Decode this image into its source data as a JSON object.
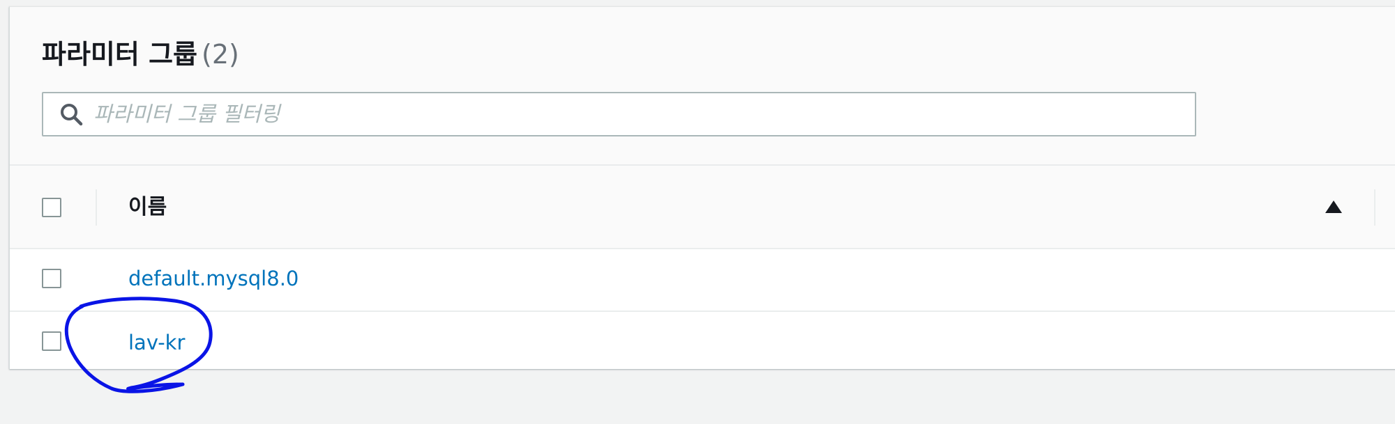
{
  "panel": {
    "title": "파라미터 그룹",
    "count": "(2)"
  },
  "search": {
    "placeholder": "파라미터 그룹 필터링",
    "value": ""
  },
  "table": {
    "columns": [
      {
        "label": "이름",
        "sort": "ascending"
      }
    ],
    "rows": [
      {
        "name": "default.mysql8.0",
        "checked": false
      },
      {
        "name": "lav-kr",
        "checked": false
      }
    ]
  },
  "colors": {
    "link": "#0073bb",
    "annotation": "#0a14e6",
    "background": "#f2f3f3"
  },
  "icons": [
    "search-icon",
    "sort-ascending-icon"
  ]
}
